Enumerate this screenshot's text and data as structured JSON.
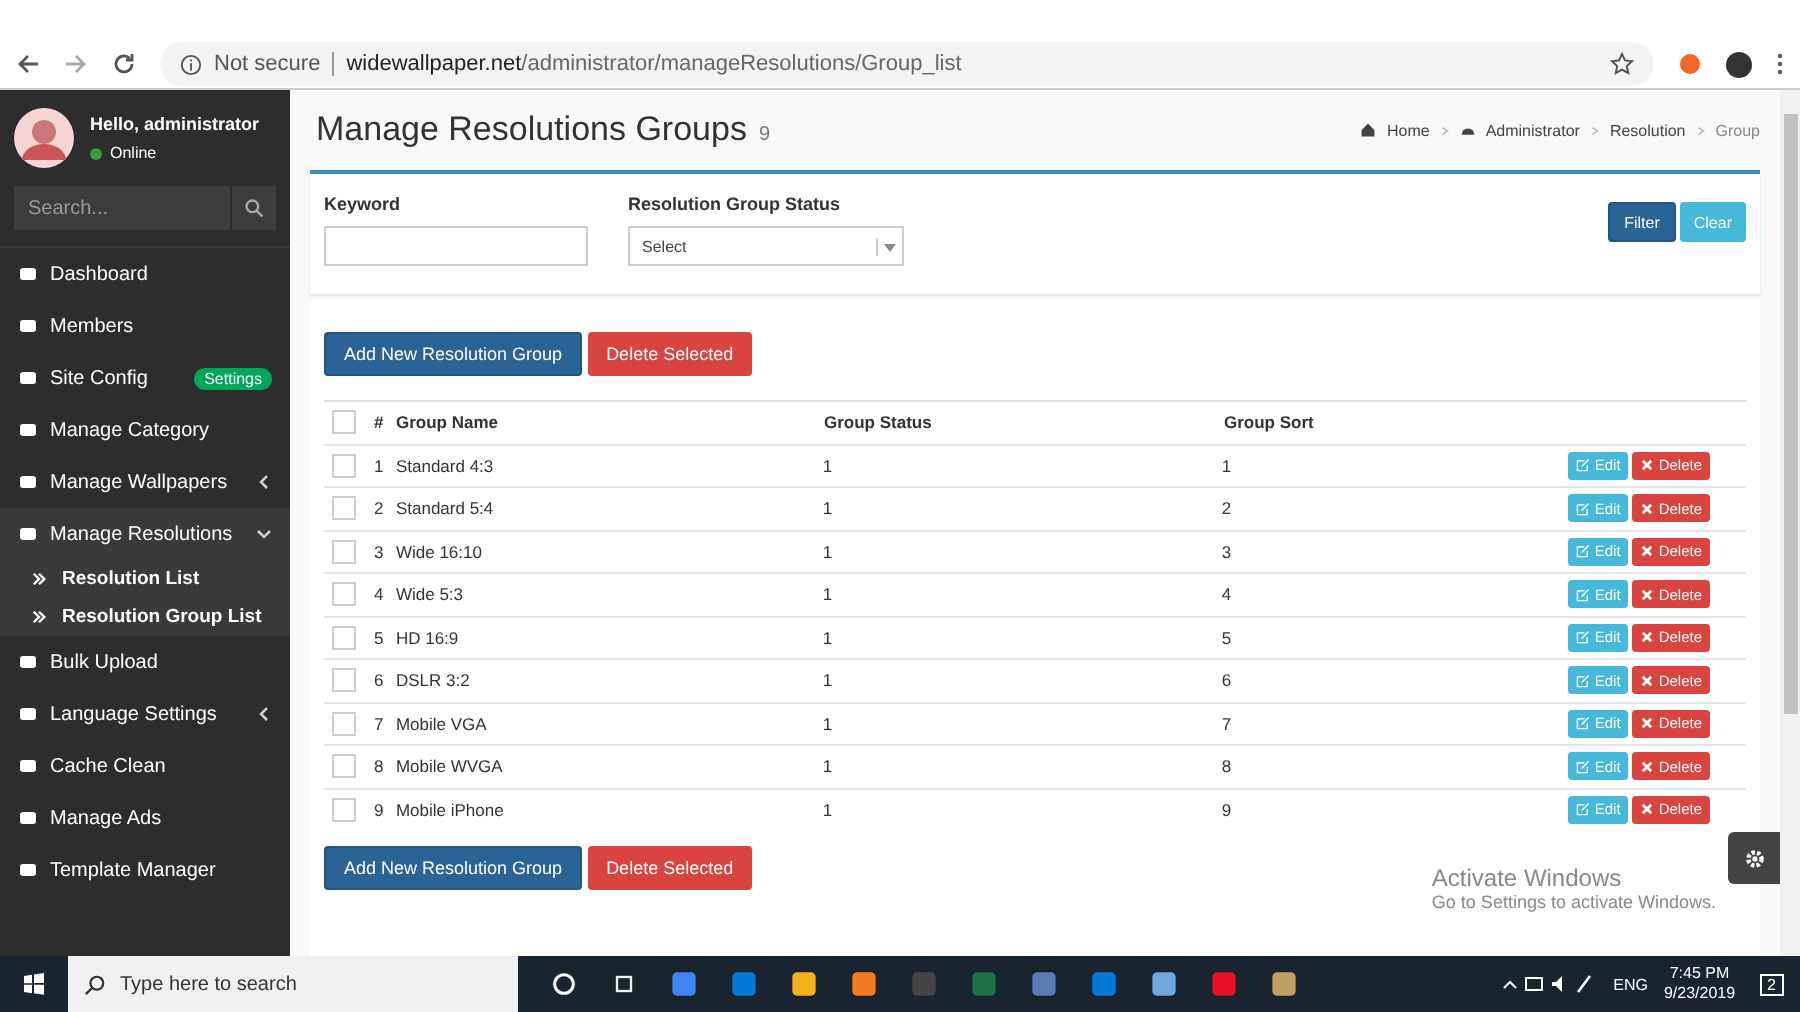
{
  "browser": {
    "security": "Not secure",
    "domain": "widewallpaper.net",
    "path": "/administrator/manageResolutions/Group_list"
  },
  "sidebar": {
    "user": {
      "greeting": "Hello, administrator",
      "status": "Online"
    },
    "search": {
      "placeholder": "Search..."
    },
    "items": [
      {
        "label": "Dashboard",
        "selected": false
      },
      {
        "label": "Members",
        "selected": false
      },
      {
        "label": "Site Config",
        "selected": false,
        "badge": "Settings"
      },
      {
        "label": "Manage Category",
        "selected": false
      },
      {
        "label": "Manage Wallpapers",
        "selected": false,
        "expanded": false
      },
      {
        "label": "Manage Resolutions",
        "selected": true,
        "expanded": true,
        "children": [
          {
            "label": "Resolution List"
          },
          {
            "label": "Resolution Group List"
          }
        ]
      },
      {
        "label": "Bulk Upload",
        "selected": false
      },
      {
        "label": "Language Settings",
        "selected": false,
        "expanded": false
      },
      {
        "label": "Cache Clean",
        "selected": false
      },
      {
        "label": "Manage Ads",
        "selected": false
      },
      {
        "label": "Template Manager",
        "selected": false
      }
    ]
  },
  "header": {
    "title": "Manage Resolutions Groups",
    "count": "9",
    "breadcrumb": [
      "Home",
      "Administrator",
      "Resolution",
      "Group"
    ]
  },
  "filter": {
    "keyword_label": "Keyword",
    "status_label": "Resolution Group Status",
    "status_value": "Select",
    "filter_button": "Filter",
    "clear_button": "Clear"
  },
  "actions_top": {
    "add": "Add New Resolution Group",
    "delete": "Delete Selected"
  },
  "table": {
    "select_all_checked": false,
    "columns": [
      "#",
      "Group Name",
      "Group Status",
      "Group Sort"
    ],
    "rows": [
      {
        "number": "1",
        "name": "Standard 4:3",
        "status": "1",
        "sort": "1",
        "checked": false,
        "edit": "Edit",
        "delete": "Delete"
      },
      {
        "number": "2",
        "name": "Standard 5:4",
        "status": "1",
        "sort": "2",
        "checked": false,
        "edit": "Edit",
        "delete": "Delete"
      },
      {
        "number": "3",
        "name": "Wide 16:10",
        "status": "1",
        "sort": "3",
        "checked": false,
        "edit": "Edit",
        "delete": "Delete"
      },
      {
        "number": "4",
        "name": "Wide 5:3",
        "status": "1",
        "sort": "4",
        "checked": false,
        "edit": "Edit",
        "delete": "Delete"
      },
      {
        "number": "5",
        "name": "HD 16:9",
        "status": "1",
        "sort": "5",
        "checked": false,
        "edit": "Edit",
        "delete": "Delete"
      },
      {
        "number": "6",
        "name": "DSLR 3:2",
        "status": "1",
        "sort": "6",
        "checked": false,
        "edit": "Edit",
        "delete": "Delete"
      },
      {
        "number": "7",
        "name": "Mobile VGA",
        "status": "1",
        "sort": "7",
        "checked": false,
        "edit": "Edit",
        "delete": "Delete"
      },
      {
        "number": "8",
        "name": "Mobile WVGA",
        "status": "1",
        "sort": "8",
        "checked": false,
        "edit": "Edit",
        "delete": "Delete"
      },
      {
        "number": "9",
        "name": "Mobile iPhone",
        "status": "1",
        "sort": "9",
        "checked": false,
        "edit": "Edit",
        "delete": "Delete"
      }
    ]
  },
  "actions_bottom": {
    "add": "Add New Resolution Group",
    "delete": "Delete Selected"
  },
  "activation": {
    "title": "Activate Windows",
    "hint": "Go to Settings to activate Windows."
  },
  "taskbar": {
    "search_placeholder": "Type here to search",
    "language": "ENG",
    "time": "7:45 PM",
    "date": "9/23/2019",
    "notifications": "2"
  }
}
